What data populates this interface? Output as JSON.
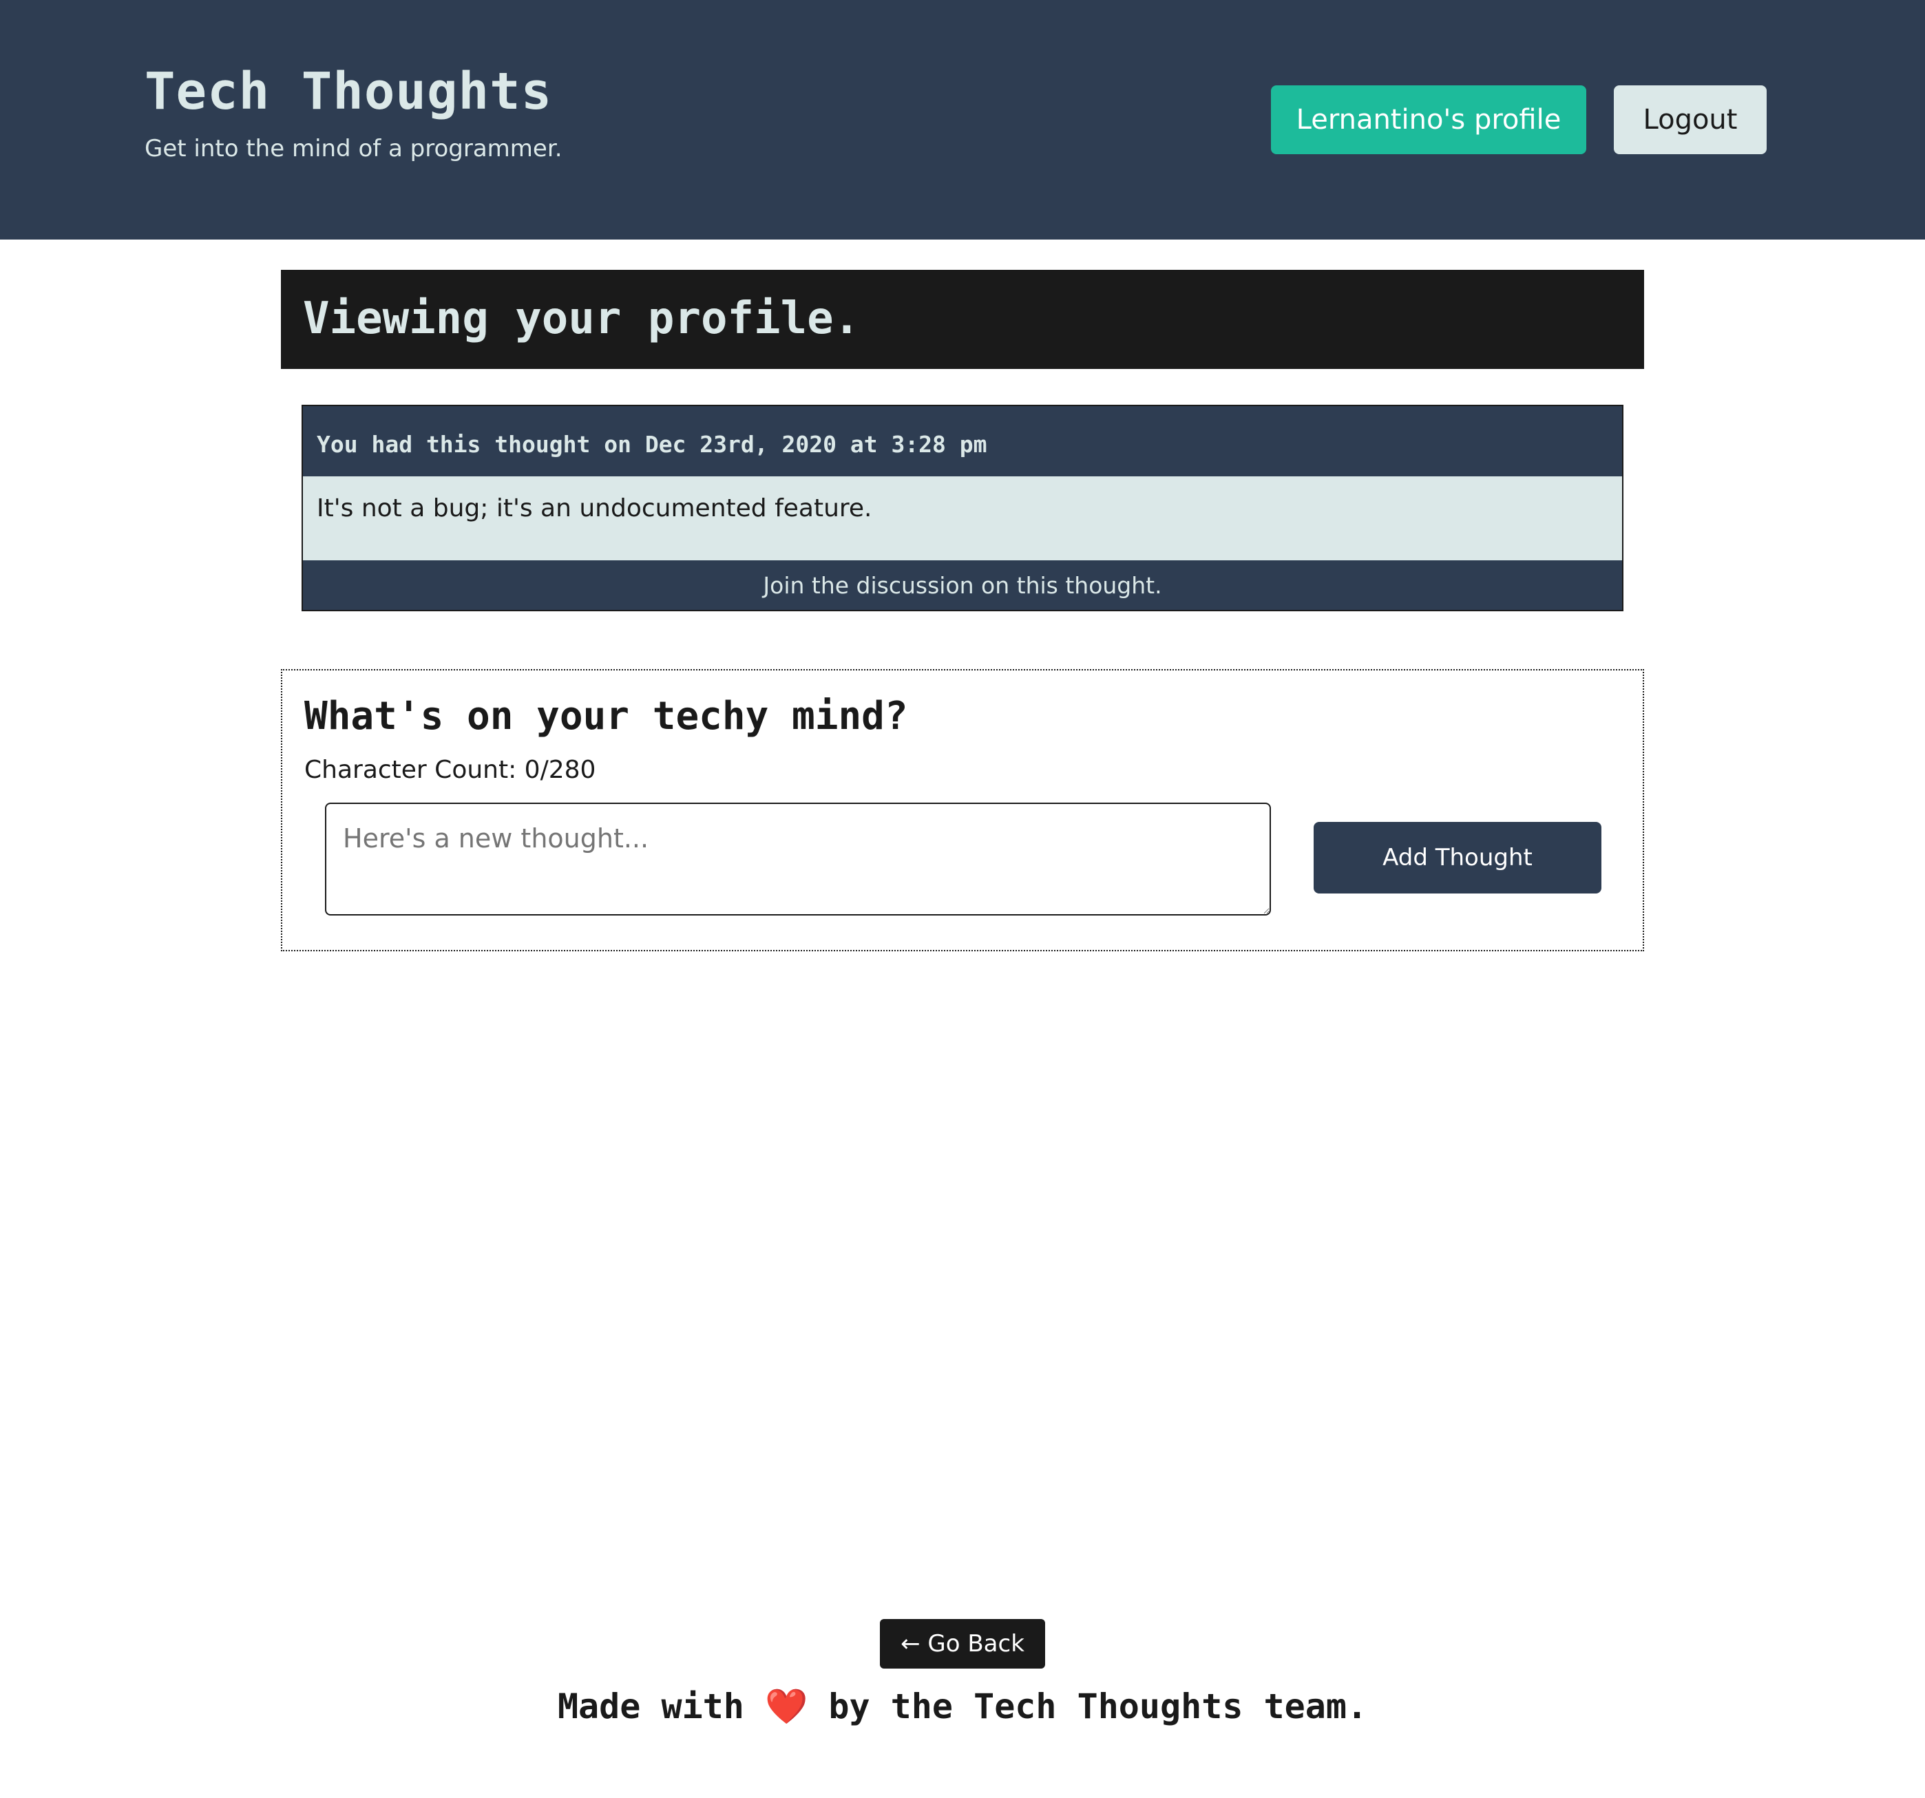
{
  "header": {
    "title": "Tech Thoughts",
    "subtitle": "Get into the mind of a programmer.",
    "profile_button_label": "Lernantino's profile",
    "logout_button_label": "Logout"
  },
  "profile": {
    "heading": "Viewing your profile."
  },
  "thoughts": [
    {
      "header_text": "You had this thought on Dec 23rd, 2020 at 3:28 pm",
      "body": "It's not a bug; it's an undocumented feature.",
      "discussion_link": "Join the discussion on this thought."
    }
  ],
  "form": {
    "heading": "What's on your techy mind?",
    "char_count_text": "Character Count: 0/280",
    "textarea_placeholder": "Here's a new thought...",
    "textarea_value": "",
    "submit_label": "Add Thought"
  },
  "footer": {
    "back_label": "← Go Back",
    "made_with_prefix": "Made with",
    "heart": "❤️",
    "made_with_suffix": "by the Tech Thoughts team."
  },
  "colors": {
    "header_bg": "#2e3d52",
    "accent": "#1dbb9b",
    "light": "#dbe8e8",
    "dark": "#1a1a1a"
  }
}
